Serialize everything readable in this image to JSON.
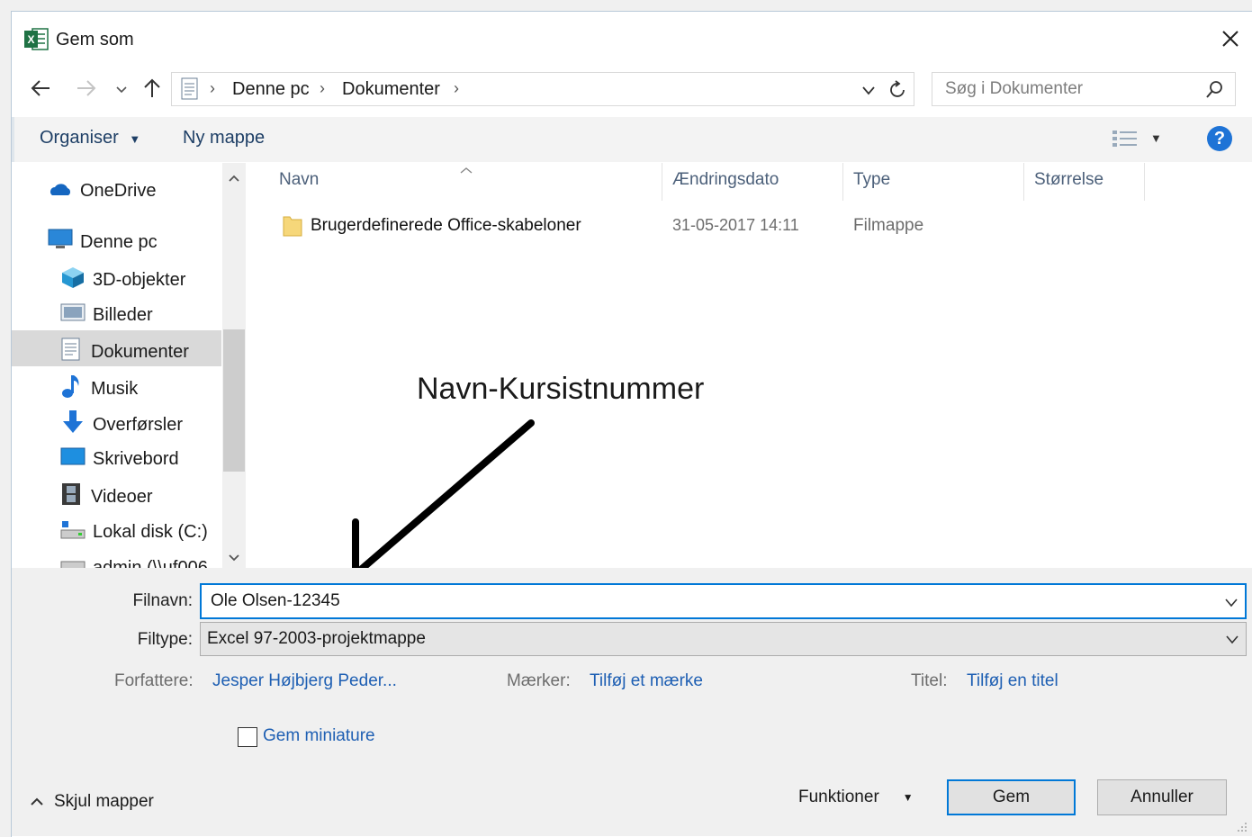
{
  "window": {
    "title": "Gem som"
  },
  "address": {
    "crumbs": [
      "Denne pc",
      "Dokumenter"
    ],
    "search_placeholder": "Søg i Dokumenter"
  },
  "toolbar": {
    "organize": "Organiser",
    "new_folder": "Ny mappe"
  },
  "sidebar": {
    "items": [
      {
        "label": "OneDrive",
        "icon": "cloud-icon"
      },
      {
        "label": "Denne pc",
        "icon": "computer-icon"
      },
      {
        "label": "3D-objekter",
        "icon": "cube-icon"
      },
      {
        "label": "Billeder",
        "icon": "pictures-icon"
      },
      {
        "label": "Dokumenter",
        "icon": "document-icon",
        "selected": true
      },
      {
        "label": "Musik",
        "icon": "music-note-icon"
      },
      {
        "label": "Overførsler",
        "icon": "download-arrow-icon"
      },
      {
        "label": "Skrivebord",
        "icon": "desktop-icon"
      },
      {
        "label": "Videoer",
        "icon": "film-icon"
      },
      {
        "label": "Lokal disk (C:)",
        "icon": "drive-icon"
      },
      {
        "label": "admin (\\\\uf006",
        "icon": "network-drive-icon"
      }
    ]
  },
  "filelist": {
    "columns": [
      "Navn",
      "Ændringsdato",
      "Type",
      "Størrelse"
    ],
    "rows": [
      {
        "name": "Brugerdefinerede Office-skabeloner",
        "date": "31-05-2017 14:11",
        "type": "Filmappe",
        "size": ""
      }
    ]
  },
  "annotation": {
    "text": "Navn-Kursistnummer"
  },
  "form": {
    "filename_label": "Filnavn:",
    "filename_value": "Ole Olsen-12345",
    "filetype_label": "Filtype:",
    "filetype_value": "Excel 97-2003-projektmappe",
    "authors_label": "Forfattere:",
    "authors_value": "Jesper Højbjerg Peder...",
    "tags_label": "Mærker:",
    "tags_value": "Tilføj et mærke",
    "title_label": "Titel:",
    "title_value": "Tilføj en titel",
    "thumbnail_label": "Gem miniature"
  },
  "footer": {
    "hide_folders": "Skjul mapper",
    "tools": "Funktioner",
    "save": "Gem",
    "cancel": "Annuller"
  },
  "colors": {
    "accent": "#0078d7",
    "link": "#1e5fb3",
    "help": "#1e73d6",
    "excel": "#1f7244"
  }
}
